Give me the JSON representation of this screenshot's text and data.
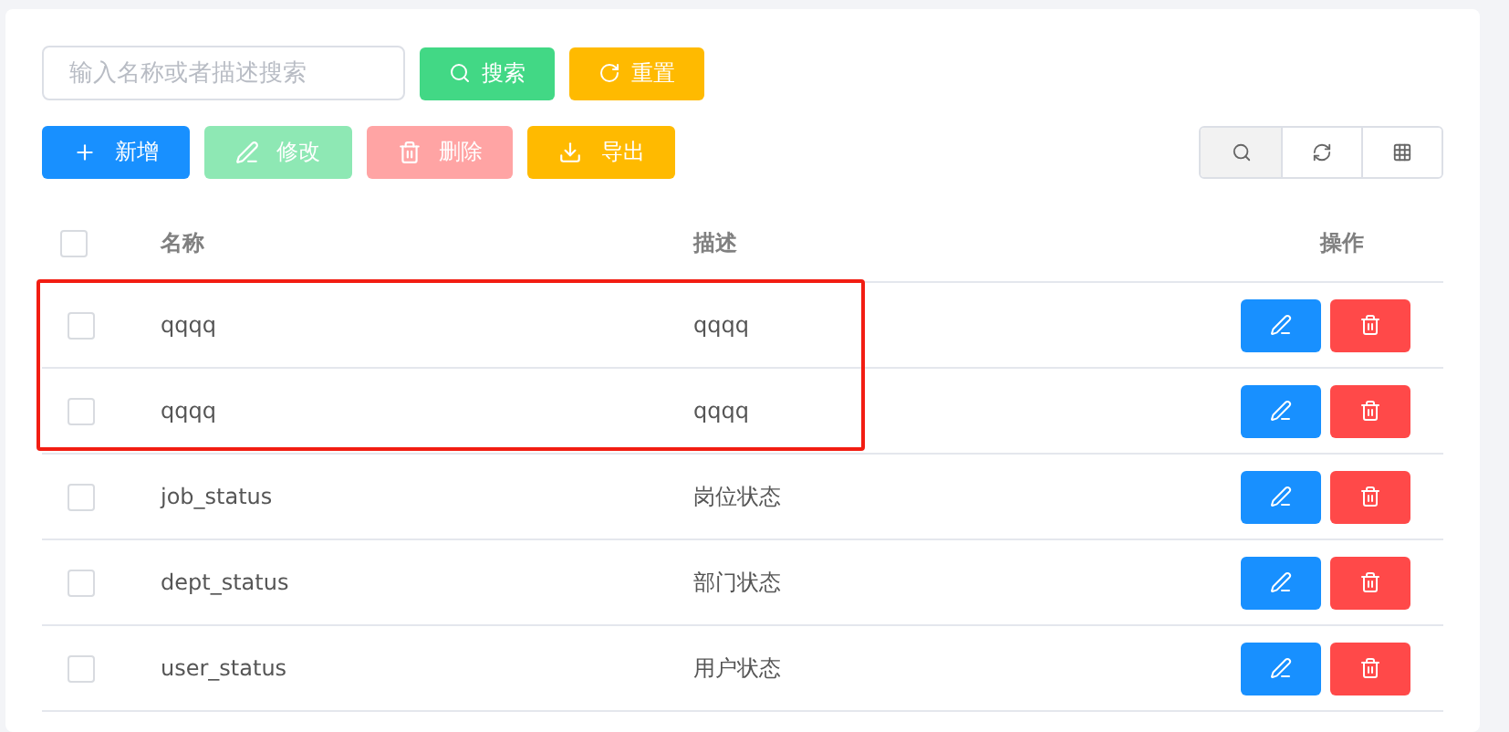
{
  "search": {
    "placeholder": "输入名称或者描述搜索"
  },
  "search_buttons": [
    {
      "kind": "search",
      "label": "搜索"
    },
    {
      "kind": "reset",
      "label": "重置"
    }
  ],
  "actions": [
    {
      "kind": "add",
      "label": "新增",
      "disabled": false
    },
    {
      "kind": "edit",
      "label": "修改",
      "disabled": true
    },
    {
      "kind": "delete",
      "label": "删除",
      "disabled": true
    },
    {
      "kind": "export",
      "label": "导出",
      "disabled": false
    }
  ],
  "tools": [
    {
      "kind": "search",
      "selected": true
    },
    {
      "kind": "refresh",
      "selected": false
    },
    {
      "kind": "columns",
      "selected": false
    }
  ],
  "table": {
    "columns": [
      "名称",
      "描述",
      "操作"
    ],
    "all_checked": false,
    "rows": [
      {
        "name": "qqqq",
        "description": "qqqq",
        "checked": false,
        "marked": true
      },
      {
        "name": "qqqq",
        "description": "qqqq",
        "checked": false,
        "marked": true
      },
      {
        "name": "job_status",
        "description": "岗位状态",
        "checked": false,
        "marked": false
      },
      {
        "name": "dept_status",
        "description": "部门状态",
        "checked": false,
        "marked": false
      },
      {
        "name": "user_status",
        "description": "用户状态",
        "checked": false,
        "marked": false
      }
    ]
  }
}
